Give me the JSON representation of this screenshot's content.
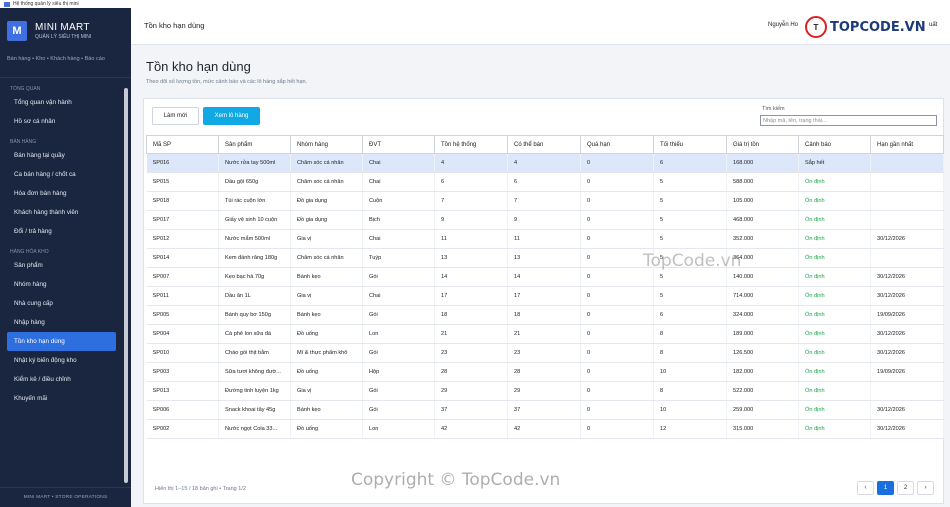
{
  "window": {
    "title": "Hệ thống quản lý siêu thị mini"
  },
  "sidebar": {
    "logo_letter": "M",
    "brand_title": "MINI MART",
    "brand_subtitle": "QUẢN LÝ SIÊU THỊ MINI",
    "quick_links": "Bán hàng • Kho • Khách hàng • Báo cáo",
    "groups": [
      {
        "title": "TỔNG QUAN",
        "items": [
          "Tổng quan vận hành",
          "Hồ sơ cá nhân"
        ]
      },
      {
        "title": "BÁN HÀNG",
        "items": [
          "Bán hàng tại quầy",
          "Ca bán hàng / chốt ca",
          "Hóa đơn bán hàng",
          "Khách hàng thành viên",
          "Đổi / trả hàng"
        ]
      },
      {
        "title": "HÀNG HÓA  KHO",
        "items": [
          "Sản phẩm",
          "Nhóm hàng",
          "Nhà cung cấp",
          "Nhập hàng",
          "Tồn kho  hạn dùng",
          "Nhật ký biến động kho",
          "Kiểm kê / điều chỉnh",
          "Khuyến mãi"
        ]
      }
    ],
    "active_item": "Tồn kho  hạn dùng",
    "footer": "MINI MART • STORE OPERATIONS"
  },
  "header": {
    "breadcrumb": "Tồn kho  hạn dùng",
    "user": "Nguyễn Ho",
    "logout": "uất"
  },
  "watermark": {
    "logo_mark": "T",
    "logo_text": "TOPCODE.VN",
    "mid": "TopCode.vn",
    "bottom": "Copyright © TopCode.vn"
  },
  "page": {
    "title": "Tồn kho  hạn dùng",
    "description": "Theo dõi số lượng tồn, mức cảnh báo và các lô hàng sắp hết hạn."
  },
  "toolbar": {
    "refresh_label": "Làm mới",
    "expiry_label": "Xem lô hàng",
    "search_label": "Tìm kiếm",
    "search_placeholder": "Nhập mã, tên, trạng thái..."
  },
  "table": {
    "columns": [
      "Mã SP",
      "Sản phẩm",
      "Nhóm hàng",
      "ĐVT",
      "Tồn hệ thống",
      "Có thể bán",
      "Quá hạn",
      "Tối thiểu",
      "Giá trị tồn",
      "Cảnh báo",
      "Hạn gần nhất"
    ],
    "rows": [
      [
        "SP016",
        "Nước rửa tay 500ml",
        "Chăm sóc cá nhân",
        "Chai",
        "4",
        "4",
        "0",
        "6",
        "168.000",
        "Sắp hết",
        ""
      ],
      [
        "SP015",
        "Dầu gội 650g",
        "Chăm sóc cá nhân",
        "Chai",
        "6",
        "6",
        "0",
        "5",
        "588.000",
        "Ổn định",
        ""
      ],
      [
        "SP018",
        "Túi rác cuộn lớn",
        "Đồ gia dụng",
        "Cuộn",
        "7",
        "7",
        "0",
        "5",
        "105.000",
        "Ổn định",
        ""
      ],
      [
        "SP017",
        "Giấy vệ sinh 10 cuộn",
        "Đồ gia dụng",
        "Bịch",
        "9",
        "9",
        "0",
        "5",
        "468.000",
        "Ổn định",
        ""
      ],
      [
        "SP012",
        "Nước mắm 500ml",
        "Gia vị",
        "Chai",
        "11",
        "11",
        "0",
        "5",
        "352.000",
        "Ổn định",
        "30/12/2026"
      ],
      [
        "SP014",
        "Kem đánh răng 180g",
        "Chăm sóc cá nhân",
        "Tuýp",
        "13",
        "13",
        "0",
        "5",
        "364.000",
        "Ổn định",
        ""
      ],
      [
        "SP007",
        "Kẹo bạc hà 70g",
        "Bánh kẹo",
        "Gói",
        "14",
        "14",
        "0",
        "5",
        "140.000",
        "Ổn định",
        "30/12/2026"
      ],
      [
        "SP011",
        "Dầu ăn 1L",
        "Gia vị",
        "Chai",
        "17",
        "17",
        "0",
        "5",
        "714.000",
        "Ổn định",
        "30/12/2026"
      ],
      [
        "SP005",
        "Bánh quy bơ 150g",
        "Bánh kẹo",
        "Gói",
        "18",
        "18",
        "0",
        "6",
        "324.000",
        "Ổn định",
        "19/09/2026"
      ],
      [
        "SP004",
        "Cà phê lon sữa đá",
        "Đồ uống",
        "Lon",
        "21",
        "21",
        "0",
        "8",
        "189.000",
        "Ổn định",
        "30/12/2026"
      ],
      [
        "SP010",
        "Cháo gói thịt bằm",
        "Mì & thực phẩm khô",
        "Gói",
        "23",
        "23",
        "0",
        "8",
        "126.500",
        "Ổn định",
        "30/12/2026"
      ],
      [
        "SP003",
        "Sữa tươi không đườ...",
        "Đồ uống",
        "Hộp",
        "28",
        "28",
        "0",
        "10",
        "182.000",
        "Ổn định",
        "19/09/2026"
      ],
      [
        "SP013",
        "Đường tinh luyện 1kg",
        "Gia vị",
        "Gói",
        "29",
        "29",
        "0",
        "8",
        "522.000",
        "Ổn định",
        ""
      ],
      [
        "SP006",
        "Snack khoai tây 45g",
        "Bánh kẹo",
        "Gói",
        "37",
        "37",
        "0",
        "10",
        "259.000",
        "Ổn định",
        "30/12/2026"
      ],
      [
        "SP002",
        "Nước ngọt Cola 33...",
        "Đồ uống",
        "Lon",
        "42",
        "42",
        "0",
        "12",
        "315.000",
        "Ổn định",
        "30/12/2026"
      ]
    ],
    "selected_row": 0
  },
  "footer": {
    "info": "Hiển thị 1–15 / 18 bản ghi • Trang 1/2",
    "pages": [
      "‹",
      "1",
      "2",
      "›"
    ],
    "current_page": "1"
  },
  "colors": {
    "sidebar_bg": "#1a2640",
    "accent": "#2e6fe0",
    "ok": "#1aa24a",
    "button_info": "#10a9e4"
  }
}
